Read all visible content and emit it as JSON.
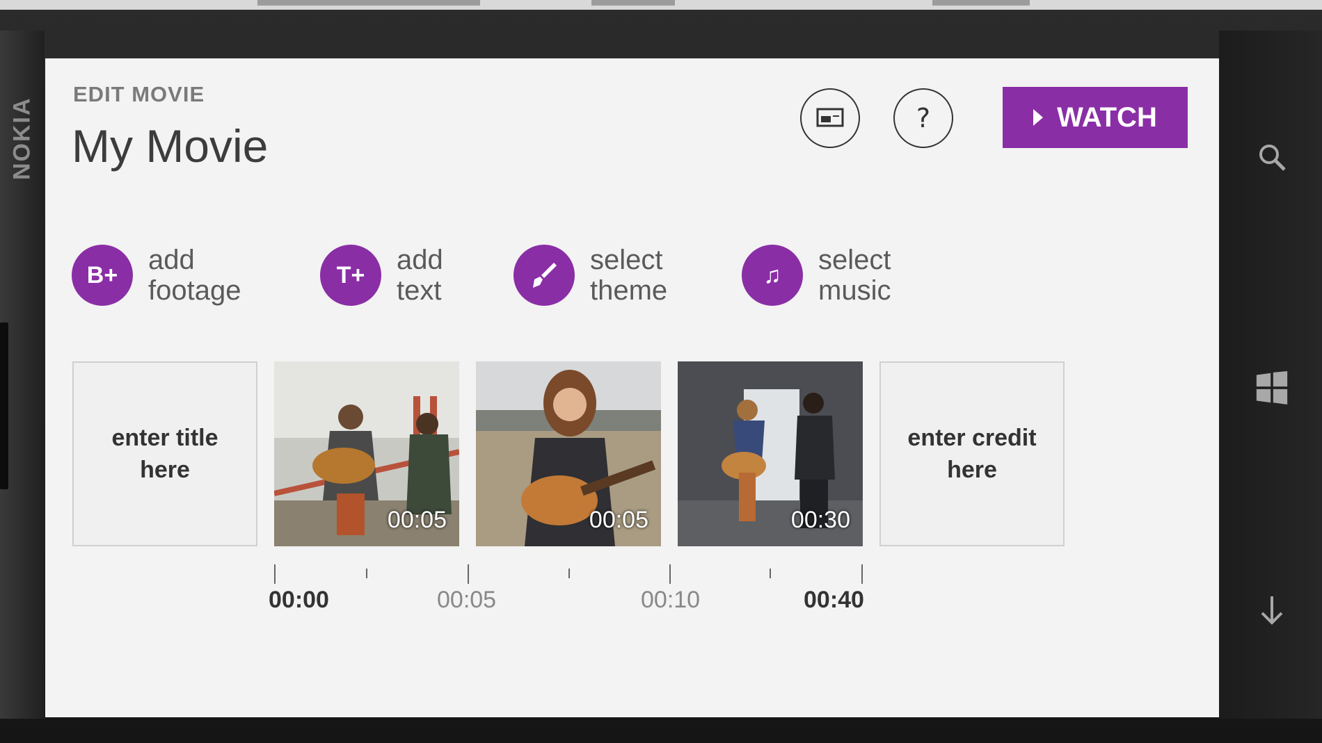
{
  "device": {
    "brand": "NOKIA"
  },
  "header": {
    "kicker": "EDIT MOVIE",
    "title": "My Movie",
    "help_label": "?",
    "watch_label": "WATCH"
  },
  "actions": [
    {
      "icon_text": "B+",
      "label_line1": "add",
      "label_line2": "footage",
      "icon": "add-footage-icon"
    },
    {
      "icon_text": "T+",
      "label_line1": "add",
      "label_line2": "text",
      "icon": "add-text-icon"
    },
    {
      "icon_text": "",
      "label_line1": "select",
      "label_line2": "theme",
      "icon": "paintbrush-icon"
    },
    {
      "icon_text": "♫",
      "label_line1": "select",
      "label_line2": "music",
      "icon": "music-note-icon"
    }
  ],
  "storyboard": {
    "title_tile": "enter title here",
    "credit_tile": "enter credit here",
    "clips": [
      {
        "duration": "00:05"
      },
      {
        "duration": "00:05"
      },
      {
        "duration": "00:30"
      }
    ]
  },
  "timeline": {
    "labels": [
      "00:00",
      "00:05",
      "00:10",
      "00:40"
    ]
  },
  "colors": {
    "accent": "#8a2ea6",
    "screen_bg": "#f3f3f3"
  }
}
